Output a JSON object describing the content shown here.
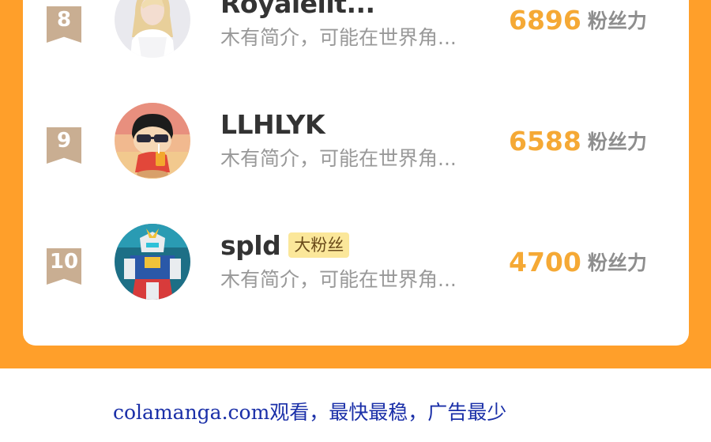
{
  "ranking": {
    "items": [
      {
        "rank": "8",
        "name": "Royaleilt...",
        "badge": "",
        "bio": "木有简介，可能在世界角...",
        "power_value": "6896",
        "power_label": "粉丝力",
        "avatar_icon": "avatar-blonde-girl"
      },
      {
        "rank": "9",
        "name": "LLHLYK",
        "badge": "",
        "bio": "木有简介，可能在世界角...",
        "power_value": "6588",
        "power_label": "粉丝力",
        "avatar_icon": "avatar-cartoon-boy-sunglasses"
      },
      {
        "rank": "10",
        "name": "spld",
        "badge": "大粉丝",
        "bio": "木有简介，可能在世界角...",
        "power_value": "4700",
        "power_label": "粉丝力",
        "avatar_icon": "avatar-robot-mecha"
      }
    ]
  },
  "footer": {
    "text": "colamanga.com观看，最快最稳，广告最少"
  },
  "colors": {
    "accent": "#ff9f2a",
    "power": "#f5a935",
    "rank_badge": "#c9ae92",
    "fan_badge": "#fbe79a",
    "footer_link": "#1a2fa8"
  }
}
